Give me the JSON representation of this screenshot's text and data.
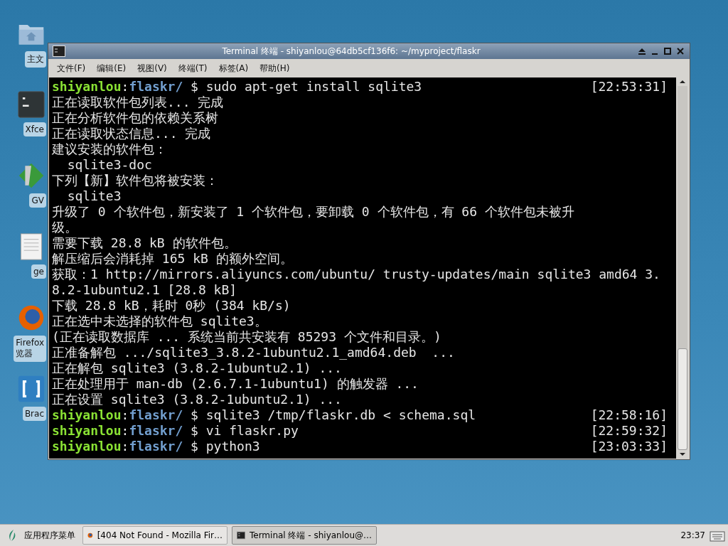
{
  "desktop_icons": [
    {
      "kind": "folder",
      "label": "主文"
    },
    {
      "kind": "terminal",
      "label": "Xfce"
    },
    {
      "kind": "vim",
      "label": "GV"
    },
    {
      "kind": "document",
      "label": "ge"
    },
    {
      "kind": "browser",
      "label": "Firefox\n览器"
    },
    {
      "kind": "bracket",
      "label": "Brac"
    }
  ],
  "window": {
    "title": "Terminal 终端 - shiyanlou@64db5cf136f6: ~/myproject/flaskr",
    "menu": [
      "文件(F)",
      "编辑(E)",
      "视图(V)",
      "终端(T)",
      "标签(A)",
      "帮助(H)"
    ],
    "lines": [
      {
        "kind": "prompt",
        "user": "shiyanlou",
        "separator": ":",
        "path": "flaskr/",
        "command": "$ sudo apt-get install sqlite3",
        "time": "[22:53:31]"
      },
      {
        "kind": "output",
        "text": "正在读取软件包列表... 完成"
      },
      {
        "kind": "output",
        "text": "正在分析软件包的依赖关系树"
      },
      {
        "kind": "output",
        "text": "正在读取状态信息... 完成"
      },
      {
        "kind": "output",
        "text": "建议安装的软件包："
      },
      {
        "kind": "output",
        "text": "  sqlite3-doc"
      },
      {
        "kind": "output",
        "text": "下列【新】软件包将被安装："
      },
      {
        "kind": "output",
        "text": "  sqlite3"
      },
      {
        "kind": "output",
        "text": "升级了 0 个软件包，新安装了 1 个软件包，要卸载 0 个软件包，有 66 个软件包未被升"
      },
      {
        "kind": "output",
        "text": "级。"
      },
      {
        "kind": "output",
        "text": "需要下载 28.8 kB 的软件包。"
      },
      {
        "kind": "output",
        "text": "解压缩后会消耗掉 165 kB 的额外空间。"
      },
      {
        "kind": "output",
        "text": "获取：1 http://mirrors.aliyuncs.com/ubuntu/ trusty-updates/main sqlite3 amd64 3."
      },
      {
        "kind": "output",
        "text": "8.2-1ubuntu2.1 [28.8 kB]"
      },
      {
        "kind": "output",
        "text": "下载 28.8 kB，耗时 0秒 (384 kB/s)"
      },
      {
        "kind": "output",
        "text": "正在选中未选择的软件包 sqlite3。"
      },
      {
        "kind": "output",
        "text": "(正在读取数据库 ... 系统当前共安装有 85293 个文件和目录。)"
      },
      {
        "kind": "output",
        "text": "正准备解包 .../sqlite3_3.8.2-1ubuntu2.1_amd64.deb  ..."
      },
      {
        "kind": "output",
        "text": "正在解包 sqlite3 (3.8.2-1ubuntu2.1) ..."
      },
      {
        "kind": "output",
        "text": "正在处理用于 man-db (2.6.7.1-1ubuntu1) 的触发器 ..."
      },
      {
        "kind": "output",
        "text": "正在设置 sqlite3 (3.8.2-1ubuntu2.1) ..."
      },
      {
        "kind": "prompt",
        "user": "shiyanlou",
        "separator": ":",
        "path": "flaskr/",
        "command": "$ sqlite3 /tmp/flaskr.db < schema.sql",
        "time": "[22:58:16]"
      },
      {
        "kind": "prompt",
        "user": "shiyanlou",
        "separator": ":",
        "path": "flaskr/",
        "command": "$ vi flaskr.py",
        "time": "[22:59:32]"
      },
      {
        "kind": "prompt",
        "user": "shiyanlou",
        "separator": ":",
        "path": "flaskr/",
        "command": "$ python3",
        "time": "[23:03:33]"
      }
    ]
  },
  "taskbar": {
    "menu_label": "应用程序菜单",
    "tasks": [
      {
        "kind": "browser",
        "label": "[404 Not Found - Mozilla Fir…",
        "selected": false
      },
      {
        "kind": "terminal",
        "label": "Terminal 终端 - shiyanlou@…",
        "selected": true
      }
    ],
    "clock": "23:37"
  }
}
